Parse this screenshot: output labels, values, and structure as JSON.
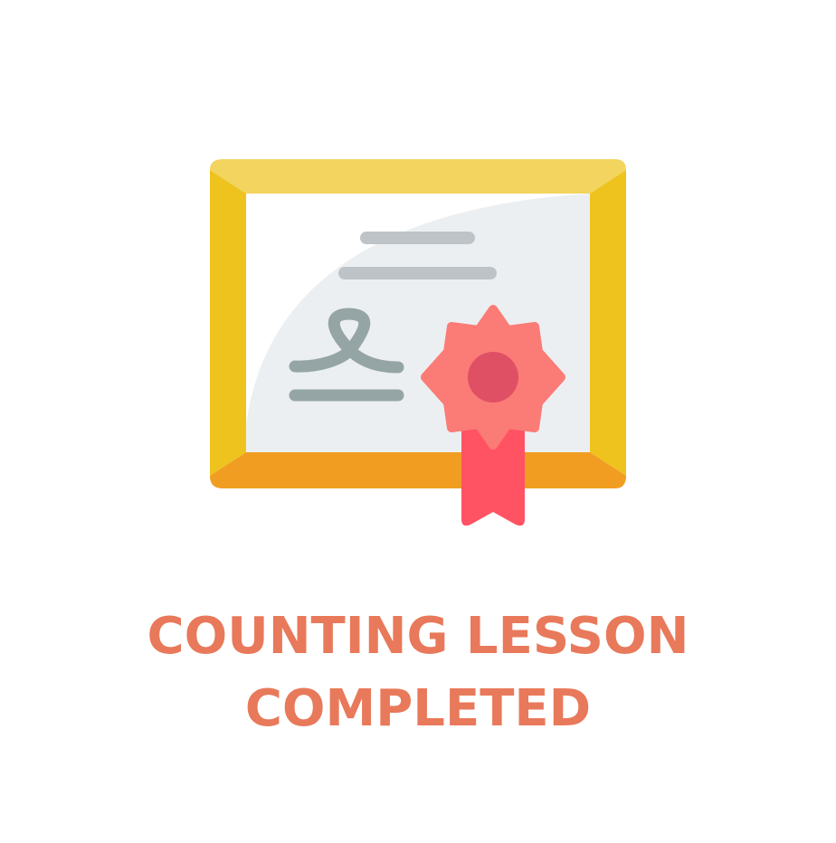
{
  "completion": {
    "title_line_1": "COUNTING LESSON",
    "title_line_2": "COMPLETED",
    "text_color": "#E8795A"
  },
  "certificate_icon": {
    "icon": "certificate-icon",
    "colors": {
      "frame_top": "#F2D45E",
      "frame_sides": "#EEC31E",
      "frame_bottom": "#F19D22",
      "paper": "#FFFFFF",
      "paper_shade": "#ECEFF1",
      "text_lines": "#BDC3C7",
      "signature": "#95A5A5",
      "rosette": "#FB7B76",
      "rosette_center": "#E05064",
      "ribbon": "#FF5364"
    }
  }
}
